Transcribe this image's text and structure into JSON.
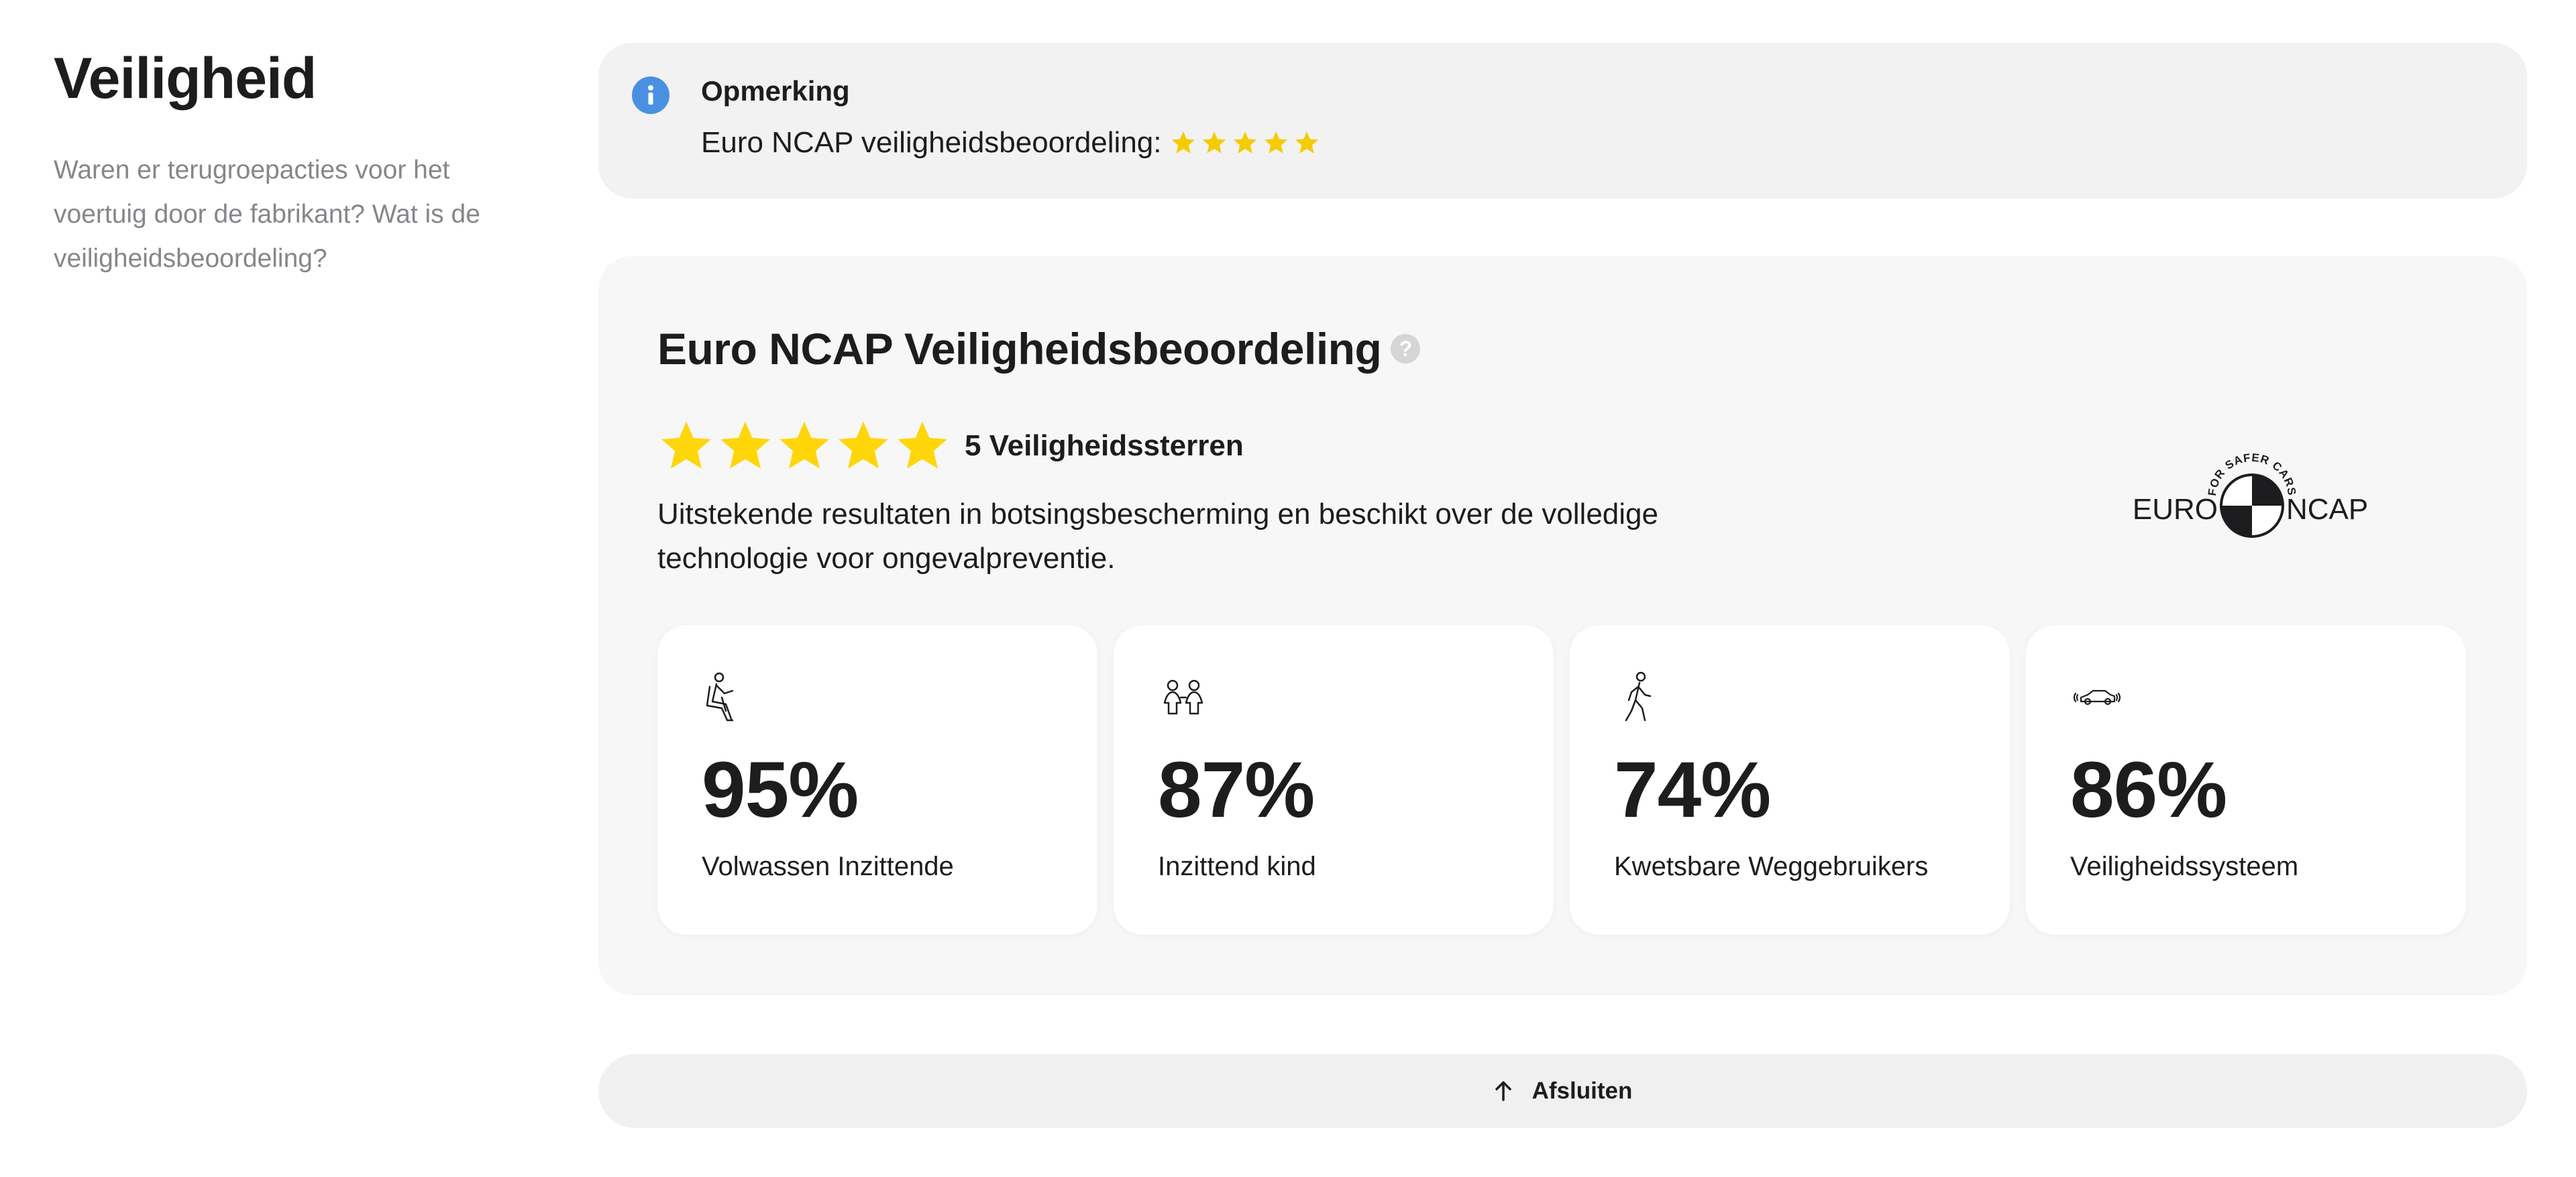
{
  "section": {
    "title": "Veiligheid",
    "description": "Waren er terugroepacties voor het voertuig door de fabrikant? Wat is de veiligheidsbeoordeling?"
  },
  "note": {
    "icon": "info-icon",
    "title": "Opmerking",
    "text": "Euro NCAP veiligheidsbeoordeling:",
    "stars": 5,
    "star_color": "#f5cc00"
  },
  "ncap": {
    "title": "Euro NCAP Veiligheidsbeoordeling",
    "help_icon": "?",
    "stars": 5,
    "star_color": "#ffd60a",
    "stars_label": "5 Veiligheidssterren",
    "description": "Uitstekende resultaten in botsingsbescherming en beschikt over de volledige technologie voor ongevalpreventie.",
    "logo": {
      "tagline": "FOR SAFER CARS",
      "left_word": "EURO",
      "right_word": "NCAP"
    },
    "cards": [
      {
        "icon": "adult-occupant-icon",
        "value": "95%",
        "label": "Volwassen Inzittende"
      },
      {
        "icon": "child-occupant-icon",
        "value": "87%",
        "label": "Inzittend kind"
      },
      {
        "icon": "pedestrian-icon",
        "value": "74%",
        "label": "Kwetsbare Weggebruikers"
      },
      {
        "icon": "safety-assist-car-icon",
        "value": "86%",
        "label": "Veiligheidssysteem"
      }
    ]
  },
  "close_button": {
    "icon": "arrow-up-icon",
    "label": "Afsluiten"
  },
  "colors": {
    "info_blue": "#4a90e2",
    "card_bg": "#f7f7f7",
    "note_bg": "#f2f2f2"
  }
}
